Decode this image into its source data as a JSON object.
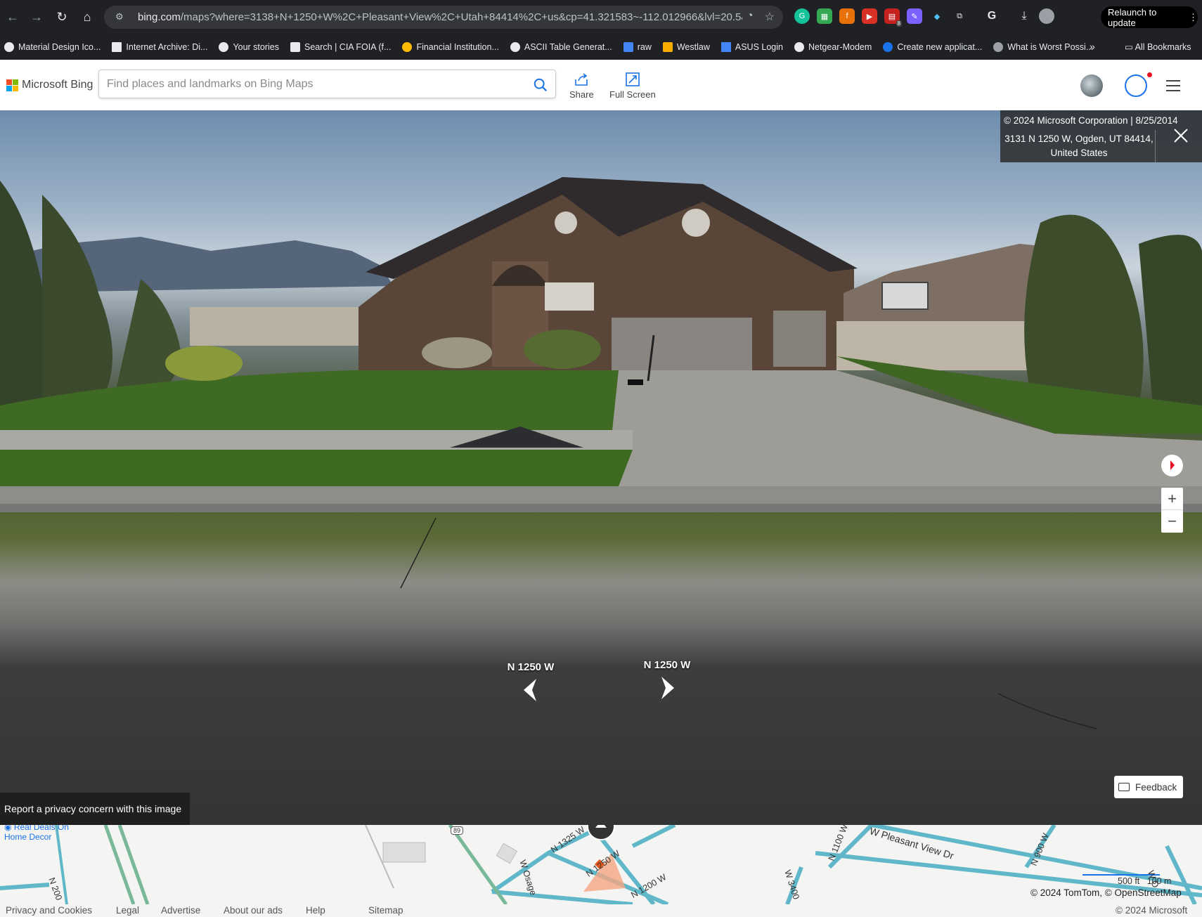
{
  "browser": {
    "url_domain": "bing.com",
    "url_rest": "/maps?where=3138+N+1250+W%2C+Pleasant+View%2C+Utah+84414%2C+us&cp=41.321583~-112.012966&lvl=20.5&pi=-1...",
    "relaunch_label": "Relaunch to update",
    "ext_badge": "8"
  },
  "bookmarks": {
    "items": [
      "Material Design Ico...",
      "Internet Archive: Di...",
      "Your stories",
      "Search | CIA FOIA (f...",
      "Financial Institution...",
      "ASCII Table Generat...",
      "raw",
      "Westlaw",
      "ASUS Login",
      "Netgear-Modem",
      "Create new applicat...",
      "What is Worst Possi..."
    ],
    "more": "»",
    "all_label": "All Bookmarks"
  },
  "header": {
    "brand": "Microsoft Bing",
    "search_placeholder": "Find places and landmarks on Bing Maps",
    "share_label": "Share",
    "fullscreen_label": "Full Screen"
  },
  "streetside": {
    "copyright": "© 2024 Microsoft Corporation | 8/25/2014",
    "address_line1": "3131 N 1250 W, Ogden, UT 84414,",
    "address_line2": "United States",
    "nav_back_label": "N 1250 W",
    "nav_forward_label": "N 1250 W",
    "privacy_label": "Report a privacy concern with this image",
    "feedback_label": "Feedback",
    "zoom_in": "+",
    "zoom_out": "−"
  },
  "minimap": {
    "labels": {
      "poi": "Real Deals On Home Decor",
      "hwy": "89",
      "n1325w": "N 1325 W",
      "n1250w": "N 1250 W",
      "n1200w": "N 1200 W",
      "wosage": "W Osage",
      "n1100w": "N 1100 W",
      "wpleasantview": "W Pleasant View Dr",
      "n900w": "N 900 W",
      "n200": "N 200",
      "w3400": "W 3400",
      "wo": "W O"
    },
    "scale_ft": "500 ft",
    "scale_m": "100 m",
    "attribution": "© 2024 TomTom, © OpenStreetMap"
  },
  "footer": {
    "links": [
      "Privacy and Cookies",
      "Legal",
      "Advertise",
      "About our ads",
      "Help",
      "Sitemap"
    ],
    "copyright": "© 2024 Microsoft"
  }
}
